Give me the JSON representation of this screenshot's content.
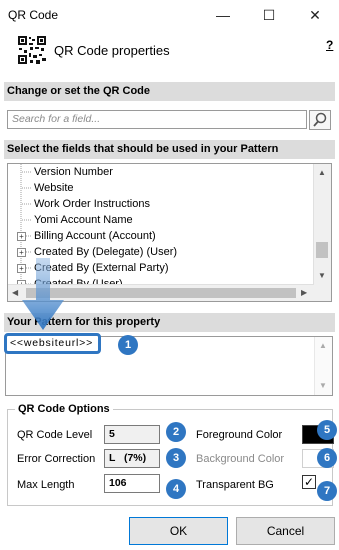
{
  "window": {
    "title": "QR Code",
    "minimize_glyph": "—",
    "maximize_glyph": "☐",
    "close_glyph": "✕"
  },
  "header": {
    "icon": "qr-code-icon",
    "title": "QR Code properties",
    "help_label": "?"
  },
  "sections": {
    "change_or_set": "Change or set the QR Code",
    "select_fields": "Select the fields that should be used in your Pattern",
    "pattern": "Your Pattern for this property"
  },
  "search": {
    "placeholder": "Search for a field...",
    "button_icon": "magnifier-icon"
  },
  "tree": {
    "items": [
      {
        "label": "Version Number",
        "expandable": false
      },
      {
        "label": "Website",
        "expandable": false
      },
      {
        "label": "Work Order Instructions",
        "expandable": false
      },
      {
        "label": "Yomi Account Name",
        "expandable": false
      },
      {
        "label": "Billing Account (Account)",
        "expandable": true
      },
      {
        "label": "Created By (Delegate) (User)",
        "expandable": true
      },
      {
        "label": "Created By (External Party)",
        "expandable": true
      },
      {
        "label": "Created By (User)",
        "expandable": true
      }
    ]
  },
  "pattern": {
    "value": "<<websiteurl>>"
  },
  "badges": [
    "1",
    "2",
    "3",
    "4",
    "5",
    "6",
    "7"
  ],
  "options": {
    "legend": "QR Code Options",
    "qr_code_level_label": "QR Code Level",
    "qr_code_level_value": "5",
    "error_correction_label": "Error Correction",
    "error_correction_value": "L   (7%)",
    "max_length_label": "Max Length",
    "max_length_value": "106",
    "foreground_color_label": "Foreground Color",
    "foreground_color": "#000000",
    "background_color_label": "Background Color",
    "background_color": "#ffffff",
    "transparent_bg_label": "Transparent BG",
    "transparent_bg_checked": true
  },
  "colors": {
    "accent": "#2f76c2",
    "section_bg": "#dcdcdc"
  },
  "footer": {
    "ok_label": "OK",
    "cancel_label": "Cancel"
  }
}
